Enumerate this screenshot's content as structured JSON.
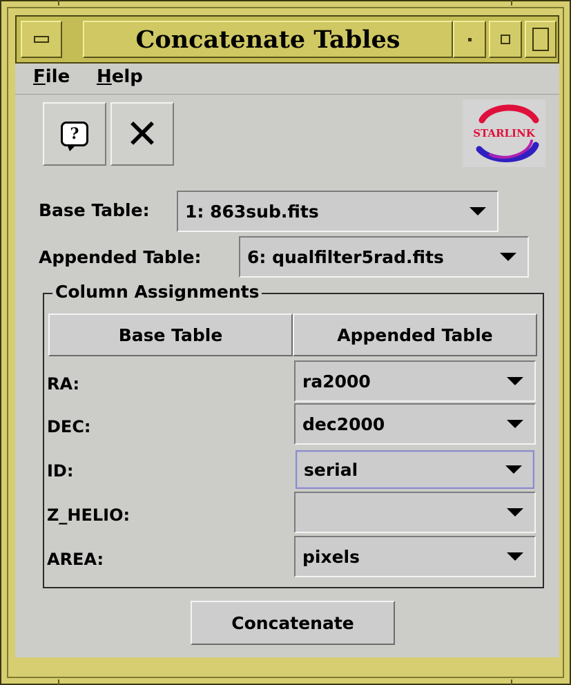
{
  "window": {
    "title": "Concatenate Tables"
  },
  "menubar": {
    "file": "File",
    "help": "Help"
  },
  "toolbar": {
    "help_icon": "help-bubble-icon",
    "close_icon": "close-x-icon",
    "logo_text": "STARLINK"
  },
  "base_table": {
    "label": "Base Table:",
    "value": "1: 863sub.fits"
  },
  "appended_table": {
    "label": "Appended Table:",
    "value": "6: qualfilter5rad.fits"
  },
  "assignments": {
    "title": "Column Assignments",
    "col_base": "Base Table",
    "col_appended": "Appended Table",
    "rows": [
      {
        "label": "RA:",
        "value": "ra2000"
      },
      {
        "label": "DEC:",
        "value": "dec2000"
      },
      {
        "label": "ID:",
        "value": "serial"
      },
      {
        "label": "Z_HELIO:",
        "value": ""
      },
      {
        "label": "AREA:",
        "value": "pixels"
      }
    ]
  },
  "actions": {
    "concatenate": "Concatenate"
  },
  "colors": {
    "frame": "#d6ce70",
    "client": "#ccccc9",
    "focus": "#8c8cc8",
    "logo_red": "#e0103c",
    "logo_blue": "#3020c0"
  }
}
